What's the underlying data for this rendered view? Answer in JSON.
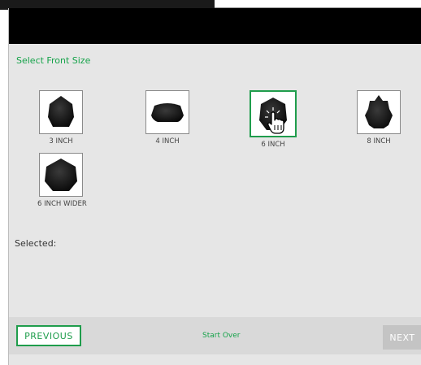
{
  "step": {
    "title": "Select Front Size"
  },
  "options": [
    {
      "label": "3 INCH",
      "icon": "front-3-inch-icon"
    },
    {
      "label": "4 INCH",
      "icon": "front-4-inch-icon"
    },
    {
      "label": "6 INCH",
      "icon": "front-6-inch-icon",
      "selected": true
    },
    {
      "label": "8 INCH",
      "icon": "front-8-inch-icon"
    },
    {
      "label": "6 INCH WIDER",
      "icon": "front-6-inch-wider-icon"
    }
  ],
  "selection": {
    "label": "Selected:"
  },
  "footer": {
    "previous_label": "PREVIOUS",
    "start_over_label": "Start Over",
    "next_label": "NEXT"
  },
  "colors": {
    "accent": "#1f9d4c",
    "header": "#000000",
    "panel": "#e6e6e6",
    "disabled": "#c4c4c4"
  }
}
